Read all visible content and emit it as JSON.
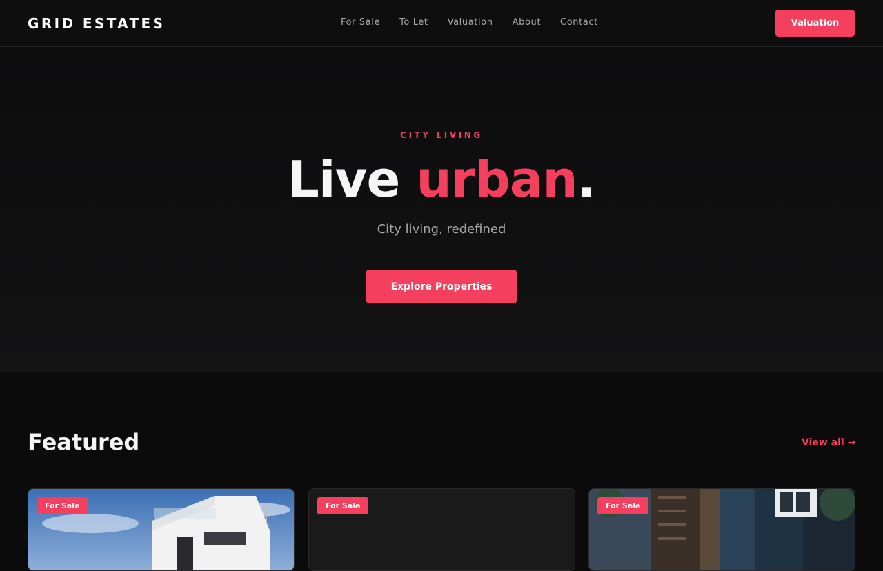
{
  "header": {
    "brand": "GRID ESTATES",
    "nav": [
      "For Sale",
      "To Let",
      "Valuation",
      "About",
      "Contact"
    ],
    "cta": "Valuation"
  },
  "hero": {
    "eyebrow": "CITY LIVING",
    "title_lead": "Live",
    "title_accent": "urban",
    "title_end": ".",
    "subtitle": "City living, redefined",
    "button": "Explore Properties"
  },
  "featured": {
    "title": "Featured",
    "view_all": "View all →",
    "cards": [
      {
        "badge": "For Sale",
        "image": "white-modern-house-blue-sky"
      },
      {
        "badge": "For Sale",
        "image": "none"
      },
      {
        "badge": "For Sale",
        "image": "dark-apartment-towers"
      }
    ]
  },
  "colors": {
    "accent": "#f43f5e",
    "background": "#0b0b0c",
    "muted_text": "#a9a9ad"
  }
}
